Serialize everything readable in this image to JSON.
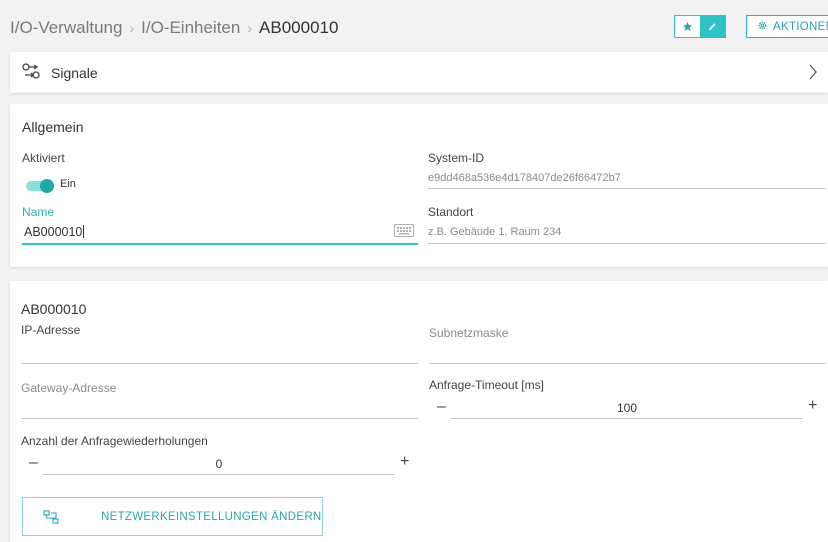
{
  "breadcrumb": {
    "items": [
      "I/O-Verwaltung",
      "I/O-Einheiten"
    ],
    "current": "AB000010",
    "separator": "›"
  },
  "header": {
    "aktionen_label": "AKTIONEN"
  },
  "signale": {
    "label": "Signale"
  },
  "allgemein": {
    "title": "Allgemein",
    "aktiviert_label": "Aktiviert",
    "toggle_text": "Ein",
    "toggle_on": true,
    "system_id_label": "System-ID",
    "system_id_value": "e9dd468a536e4d178407de26f66472b7",
    "name_label": "Name",
    "name_value": "AB000010",
    "standort_label": "Standort",
    "standort_placeholder": "z.B. Gebäude 1, Raum 234"
  },
  "network": {
    "title": "AB000010",
    "ip_label": "IP-Adresse",
    "ip_value": "",
    "subnet_label": "Subnetzmaske",
    "gateway_label": "Gateway-Adresse",
    "timeout_label": "Anfrage-Timeout [ms]",
    "timeout_value": "100",
    "retries_label": "Anzahl der Anfragewiederholungen",
    "retries_value": "0",
    "minus": "–",
    "plus": "+",
    "change_button": "NETZWERKEINSTELLUNGEN ÄNDERN"
  },
  "colors": {
    "accent": "#2fc3c3",
    "background": "#f2f2f2"
  },
  "icons": [
    "star-icon",
    "edit-icon",
    "gear-icon",
    "signal-icon",
    "chevron-right-icon",
    "keyboard-icon",
    "network-icon"
  ]
}
